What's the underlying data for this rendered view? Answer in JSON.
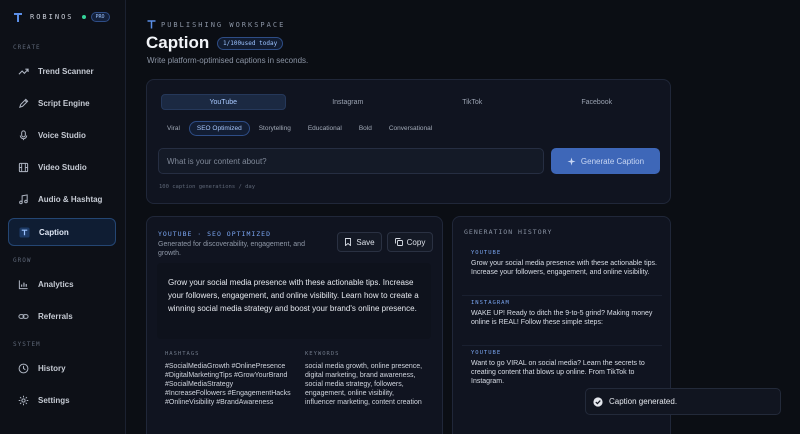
{
  "brand": {
    "name": "ROBINOS",
    "plan_badge": "PRO"
  },
  "sidebar": {
    "sections": [
      {
        "label": "CREATE",
        "items": [
          {
            "label": "Trend Scanner",
            "icon": "trend-icon"
          },
          {
            "label": "Script Engine",
            "icon": "pen-icon"
          },
          {
            "label": "Voice Studio",
            "icon": "microphone-icon"
          },
          {
            "label": "Video Studio",
            "icon": "film-icon"
          },
          {
            "label": "Audio & Hashtag",
            "icon": "music-icon"
          },
          {
            "label": "Caption",
            "icon": "text-icon",
            "active": true
          }
        ]
      },
      {
        "label": "GROW",
        "items": [
          {
            "label": "Analytics",
            "icon": "chart-icon"
          },
          {
            "label": "Referrals",
            "icon": "link-icon"
          }
        ]
      },
      {
        "label": "SYSTEM",
        "items": [
          {
            "label": "History",
            "icon": "clock-icon"
          },
          {
            "label": "Settings",
            "icon": "gear-icon"
          }
        ]
      }
    ]
  },
  "header": {
    "eyebrow": "PUBLISHING WORKSPACE",
    "title": "Caption",
    "usage_badge": "1/100used today",
    "subtitle": "Write platform-optimised captions in seconds."
  },
  "composer": {
    "platforms": [
      "YouTube",
      "Instagram",
      "TikTok",
      "Facebook"
    ],
    "active_platform": "YouTube",
    "styles": [
      "Viral",
      "SEO Optimized",
      "Storytelling",
      "Educational",
      "Bold",
      "Conversational"
    ],
    "active_style": "SEO Optimized",
    "input_placeholder": "What is your content about?",
    "input_value": "",
    "generate_label": "Generate Caption",
    "limit_note": "100 caption generations / day"
  },
  "result": {
    "label": "YOUTUBE · SEO OPTIMIZED",
    "description": "Generated for discoverability, engagement, and growth.",
    "save_label": "Save",
    "copy_label": "Copy",
    "caption": "Grow your social media presence with these actionable tips. Increase your followers, engagement, and online visibility. Learn how to create a winning social media strategy and boost your brand's online presence.",
    "hashtags_label": "HASHTAGS",
    "hashtags": "#SocialMediaGrowth #OnlinePresence #DigitalMarketingTips #GrowYourBrand #SocialMediaStrategy #IncreaseFollowers #EngagementHacks #OnlineVisibility #BrandAwareness",
    "keywords_label": "KEYWORDS",
    "keywords": "social media growth, online presence, digital marketing, brand awareness, social media strategy, followers, engagement, online visibility, influencer marketing, content creation"
  },
  "history": {
    "title": "GENERATION HISTORY",
    "items": [
      {
        "platform": "YOUTUBE",
        "text": "Grow your social media presence with these actionable tips. Increase your followers, engagement, and online visibility."
      },
      {
        "platform": "INSTAGRAM",
        "text": "WAKE UP! Ready to ditch the 9-to-5 grind? Making money online is REAL! Follow these simple steps:"
      },
      {
        "platform": "YOUTUBE",
        "text": "Want to go VIRAL on social media? Learn the secrets to creating content that blows up online. From TikTok to Instagram."
      }
    ]
  },
  "toast": {
    "text": "Caption generated."
  },
  "colors": {
    "accent": "#3e67b8",
    "accent_text": "#7aa5f0",
    "success": "#34d399",
    "background": "#0b0e14"
  }
}
